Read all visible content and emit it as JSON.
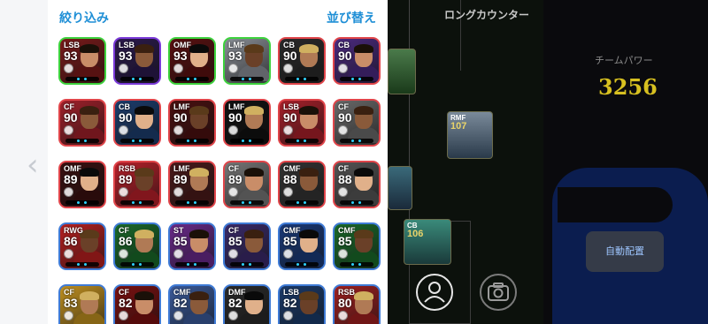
{
  "header": {
    "filter_label": "絞り込み",
    "sort_label": "並び替え",
    "counter_label": "ロングカウンター"
  },
  "team": {
    "power_label": "チームパワー",
    "power_value": "3256",
    "auto_arrange_label": "自動配置"
  },
  "colors": {
    "accent_blue": "#1f8fd6",
    "power_yellow": "#d7c020"
  },
  "icons": [
    "chevron-left-icon",
    "person-icon",
    "camera-icon"
  ],
  "players": [
    {
      "pos": "LSB",
      "rating": "93",
      "border": "#3dd23d",
      "bg": "#7b1a1a"
    },
    {
      "pos": "LSB",
      "rating": "93",
      "border": "#7a3ad8",
      "bg": "#2b1a4d"
    },
    {
      "pos": "OMF",
      "rating": "93",
      "border": "#3dd23d",
      "bg": "#5a1010"
    },
    {
      "pos": "LMF",
      "rating": "93",
      "border": "#3dd23d",
      "bg": "#8a8f97"
    },
    {
      "pos": "CB",
      "rating": "90",
      "border": "#e0454a",
      "bg": "#2a2a2a"
    },
    {
      "pos": "CB",
      "rating": "90",
      "border": "#e0454a",
      "bg": "#4b2a80"
    },
    {
      "pos": "CF",
      "rating": "90",
      "border": "#e0454a",
      "bg": "#a0202a"
    },
    {
      "pos": "CB",
      "rating": "90",
      "border": "#e0454a",
      "bg": "#1c3d6e"
    },
    {
      "pos": "LMF",
      "rating": "90",
      "border": "#e0454a",
      "bg": "#4a1010"
    },
    {
      "pos": "LMF",
      "rating": "90",
      "border": "#e0454a",
      "bg": "#111"
    },
    {
      "pos": "LSB",
      "rating": "90",
      "border": "#e0454a",
      "bg": "#a8202a"
    },
    {
      "pos": "CF",
      "rating": "90",
      "border": "#e0454a",
      "bg": "#6a6a6a"
    },
    {
      "pos": "OMF",
      "rating": "89",
      "border": "#e0454a",
      "bg": "#3a1010"
    },
    {
      "pos": "RSB",
      "rating": "89",
      "border": "#e0454a",
      "bg": "#b8202a"
    },
    {
      "pos": "LMF",
      "rating": "89",
      "border": "#e0454a",
      "bg": "#4a1a1a"
    },
    {
      "pos": "CF",
      "rating": "89",
      "border": "#e0454a",
      "bg": "#777"
    },
    {
      "pos": "CMF",
      "rating": "88",
      "border": "#e0454a",
      "bg": "#333"
    },
    {
      "pos": "CF",
      "rating": "88",
      "border": "#e0454a",
      "bg": "#555"
    },
    {
      "pos": "RWG",
      "rating": "86",
      "border": "#3f7bd6",
      "bg": "#b82020"
    },
    {
      "pos": "CF",
      "rating": "86",
      "border": "#3f7bd6",
      "bg": "#1a6a2a"
    },
    {
      "pos": "ST",
      "rating": "85",
      "border": "#3f7bd6",
      "bg": "#6a2a8a"
    },
    {
      "pos": "CF",
      "rating": "85",
      "border": "#3f7bd6",
      "bg": "#3a2a6a"
    },
    {
      "pos": "CMF",
      "rating": "85",
      "border": "#3f7bd6",
      "bg": "#1a3a7a"
    },
    {
      "pos": "CMF",
      "rating": "85",
      "border": "#3f7bd6",
      "bg": "#1a6a2a"
    },
    {
      "pos": "CF",
      "rating": "83",
      "border": "#3f7bd6",
      "bg": "#c09020"
    },
    {
      "pos": "CF",
      "rating": "82",
      "border": "#3f7bd6",
      "bg": "#7a1010"
    },
    {
      "pos": "CMF",
      "rating": "82",
      "border": "#3f7bd6",
      "bg": "#3a5a9a"
    },
    {
      "pos": "DMF",
      "rating": "82",
      "border": "#3f7bd6",
      "bg": "#2a2a2a"
    },
    {
      "pos": "LSB",
      "rating": "82",
      "border": "#3f7bd6",
      "bg": "#1a3a6a"
    },
    {
      "pos": "RSB",
      "rating": "80",
      "border": "#3f7bd6",
      "bg": "#a02020"
    }
  ],
  "field_cards": [
    {
      "pos": "RMF",
      "rating": "107"
    },
    {
      "pos": "CB",
      "rating": "106"
    }
  ]
}
